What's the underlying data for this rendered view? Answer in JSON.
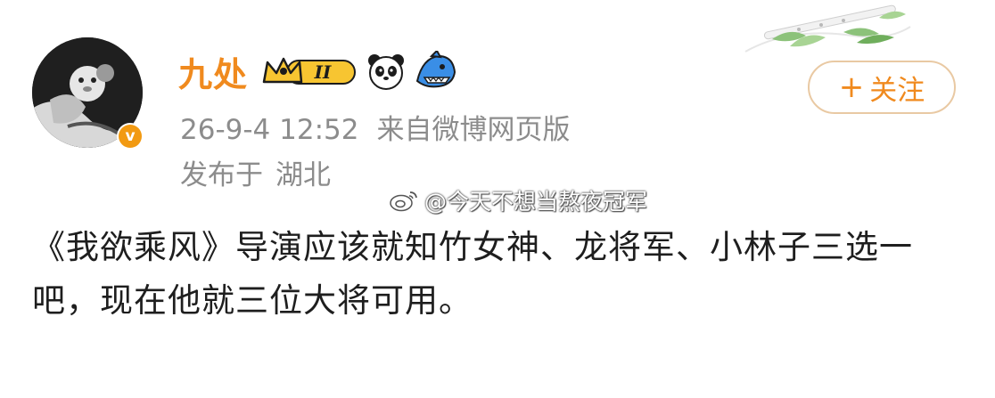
{
  "post": {
    "author": {
      "name": "九处",
      "level_badge": "II",
      "verified_mark": "v"
    },
    "meta": {
      "date": "26-9-4 12:52",
      "source": "来自微博网页版"
    },
    "location": {
      "prefix": "发布于",
      "place": "湖北"
    },
    "follow_button": {
      "icon": "+",
      "label": "关注"
    },
    "watermark": "@今天不想当熬夜冠军",
    "text": "《我欲乘风》导演应该就知竹女神、龙将军、小林子三选一吧，现在他就三位大将可用。"
  },
  "icons": {
    "crown_badge": "crown-level-icon",
    "panda": "panda-icon",
    "shark": "shark-icon",
    "weibo": "weibo-logo-icon"
  },
  "colors": {
    "accent": "#f08a1e",
    "meta_text": "#8c8c8c",
    "body_text": "#1e1e1e",
    "verified": "#f29a12",
    "follow_border": "#e9c9a3"
  }
}
